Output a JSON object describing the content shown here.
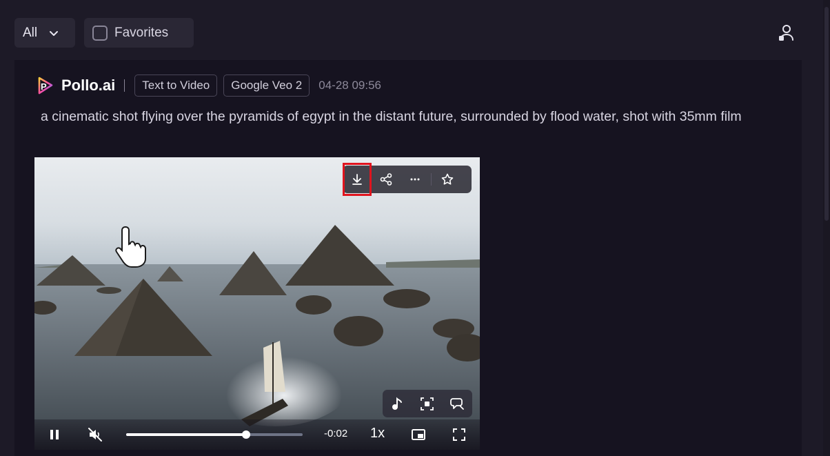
{
  "topbar": {
    "filter_value": "All",
    "favorites_label": "Favorites",
    "favorites_checked": false
  },
  "card": {
    "brand": "Pollo.ai",
    "mode_tag": "Text to Video",
    "model_tag": "Google Veo 2",
    "timestamp": "04-28 09:56",
    "prompt": "a cinematic shot flying over the pyramids of egypt in the distant future, surrounded by flood water, shot with 35mm film"
  },
  "video": {
    "action_icons": [
      "download-icon",
      "share-icon",
      "more-icon",
      "star-icon"
    ],
    "tool_icons": [
      "music-note-icon",
      "screenshot-icon",
      "speech-bubble-icon"
    ],
    "time_remaining": "-0:02",
    "speed": "1x",
    "progress": 0.68,
    "paused": false,
    "muted": true
  },
  "colors": {
    "background": "#1d1a27",
    "card": "#161320",
    "highlight": "#e0141e"
  }
}
